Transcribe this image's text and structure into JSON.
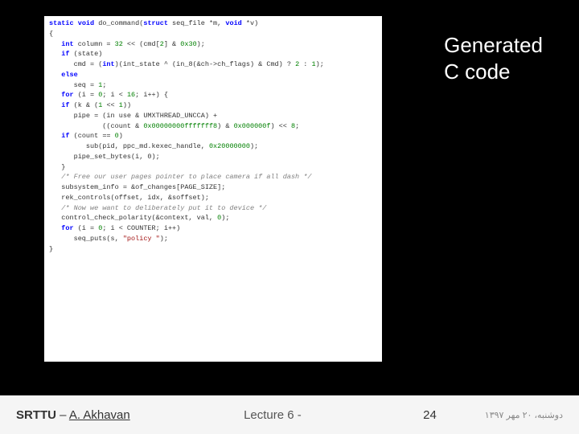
{
  "annotation": {
    "line1": "Generated",
    "line2": "C code"
  },
  "code": {
    "l0_a": "static",
    "l0_b": "void",
    "l0_c": " do_command(",
    "l0_d": "struct",
    "l0_e": " seq_file *m, ",
    "l0_f": "void",
    "l0_g": " *v)",
    "l1": "{",
    "l2_a": "   int",
    "l2_b": " column = ",
    "l2_c": "32",
    "l2_d": " << (cmd[",
    "l2_e": "2",
    "l2_f": "] & ",
    "l2_g": "0x30",
    "l2_h": ");",
    "l3_a": "   if",
    "l3_b": " (state)",
    "l4_a": "      cmd = (",
    "l4_b": "int",
    "l4_c": ")(int_state ^ (in_8(&ch->ch_flags) & Cmd) ? ",
    "l4_d": "2",
    "l4_e": " : ",
    "l4_f": "1",
    "l4_g": ");",
    "l5_a": "   else",
    "l6_a": "      seq = ",
    "l6_b": "1",
    "l6_c": ";",
    "l7_a": "   for",
    "l7_b": " (i = ",
    "l7_c": "0",
    "l7_d": "; i < ",
    "l7_e": "16",
    "l7_f": "; i++) {",
    "l8_a": "   if",
    "l8_b": " (k & (",
    "l8_c": "1",
    "l8_d": " << ",
    "l8_e": "1",
    "l8_f": "))",
    "l9_a": "      pipe = (in use & UMXTHREAD_UNCCA) +",
    "l10_a": "             ((count & ",
    "l10_b": "0x00000000fffffff8",
    "l10_c": ") & ",
    "l10_d": "0x000000f",
    "l10_e": ") << ",
    "l10_f": "8",
    "l10_g": ";",
    "l11_a": "   if",
    "l11_b": " (count == ",
    "l11_c": "0",
    "l11_d": ")",
    "l12_a": "         sub(pid, ppc_md.kexec_handle, ",
    "l12_b": "0x20000000",
    "l12_c": ");",
    "l13": "      pipe_set_bytes(i, 0);",
    "l14": "   }",
    "l15": "   /* Free our user pages pointer to place camera if all dash */",
    "l16": "   subsystem_info = &of_changes[PAGE_SIZE];",
    "l17": "   rek_controls(offset, idx, &soffset);",
    "l18": "   /* Now we want to deliberately put it to device */",
    "l19_a": "   control_check_polarity(&context, val, ",
    "l19_b": "0",
    "l19_c": ");",
    "l20_a": "   for",
    "l20_b": " (i = ",
    "l20_c": "0",
    "l20_d": "; i < COUNTER; i++)",
    "l21_a": "      seq_puts(s, ",
    "l21_b": "\"policy \"",
    "l21_c": ");",
    "l22": "}"
  },
  "footer": {
    "university": "SRTTU",
    "separator": " – ",
    "author": "A. Akhavan",
    "center": "Lecture 6 -",
    "pagenum": "24",
    "date": "دوشنبه، ۲۰ مهر ۱۳۹۷"
  }
}
